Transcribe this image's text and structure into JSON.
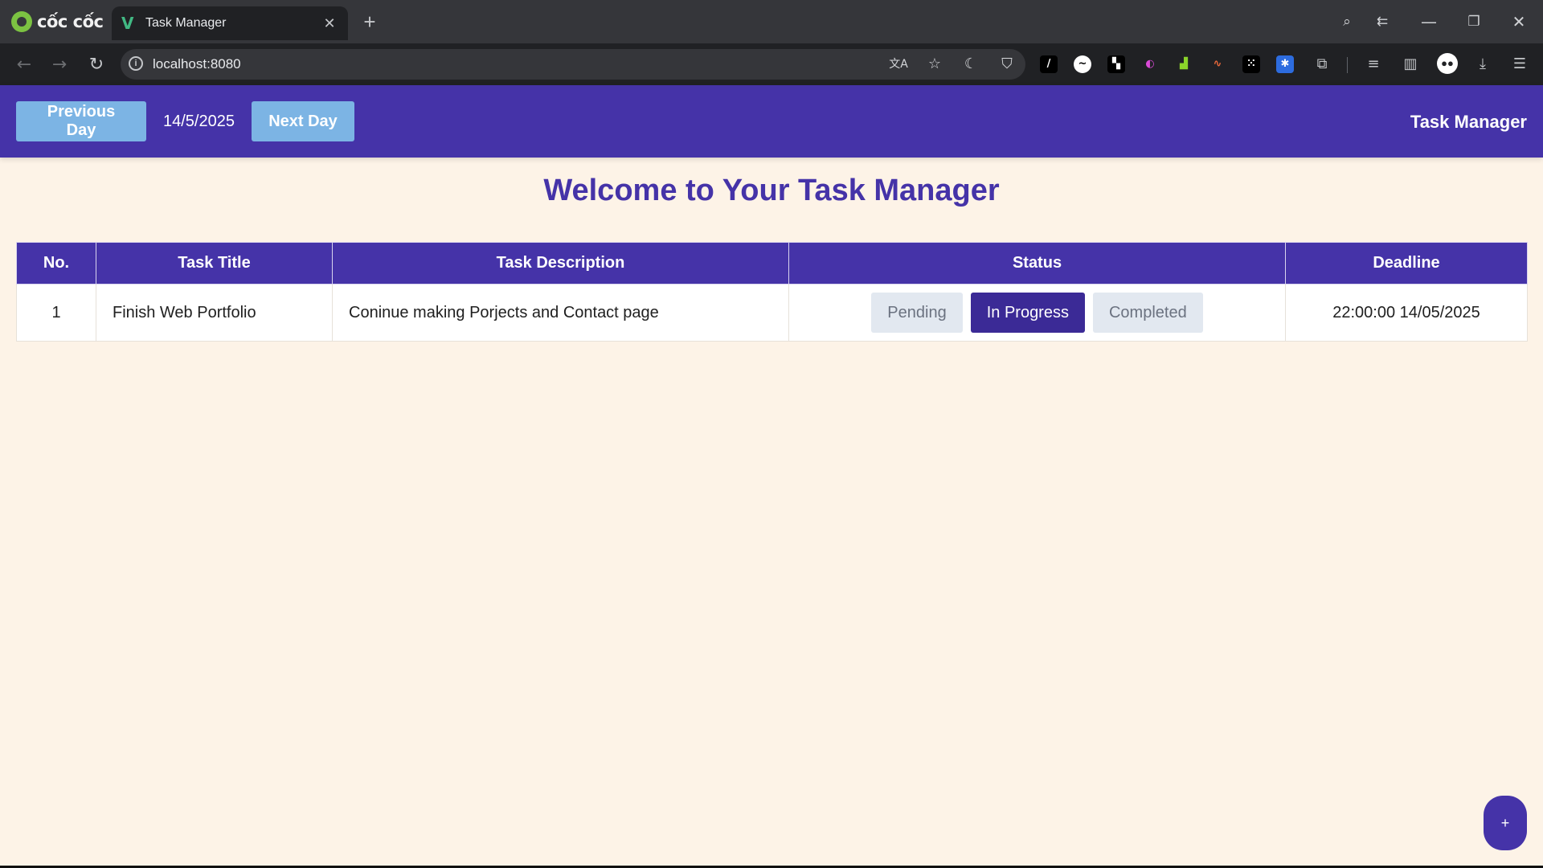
{
  "browser": {
    "brand": "cốc cốc",
    "tab_title": "Task Manager",
    "tab_close": "✕",
    "new_tab": "+",
    "url": "localhost:8080",
    "icons": {
      "back": "←",
      "forward": "→",
      "reload": "↻",
      "translate": "文A",
      "bookmark": "☆",
      "dark_mode": "☾",
      "shield": "⛉",
      "extensions": "⧉",
      "reading_list": "≡",
      "sidebar": "▥",
      "download": "⤓",
      "menu": "☰",
      "minimize": "—",
      "restore": "❐",
      "close": "✕",
      "screen_search": "⌕",
      "history_back": "⇇"
    }
  },
  "header": {
    "prev_label": "Previous Day",
    "date": "14/5/2025",
    "next_label": "Next Day",
    "title": "Task Manager"
  },
  "main": {
    "heading": "Welcome to Your Task Manager"
  },
  "table": {
    "columns": [
      "No.",
      "Task Title",
      "Task Description",
      "Status",
      "Deadline"
    ],
    "rows": [
      {
        "no": "1",
        "title": "Finish Web Portfolio",
        "description": "Coninue making Porjects and Contact page",
        "statuses": [
          "Pending",
          "In Progress",
          "Completed"
        ],
        "active_status": "In Progress",
        "deadline": "22:00:00 14/05/2025"
      }
    ]
  },
  "fab_label": "+",
  "colors": {
    "primary": "#4533a8",
    "day_button": "#7cb4e4",
    "page_bg": "#fdf3e7",
    "status_inactive": "#e2e8f0",
    "status_active": "#3b2a96"
  }
}
